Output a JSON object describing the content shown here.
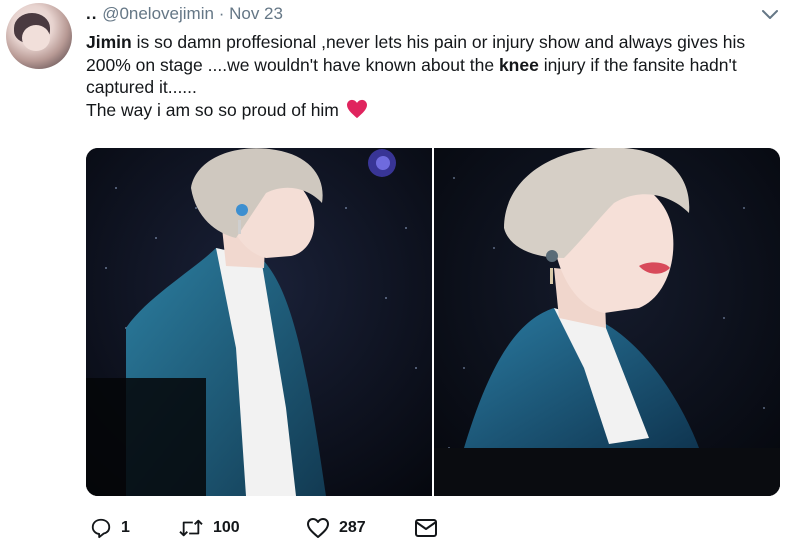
{
  "tweet": {
    "display_name": "..",
    "handle": "@0nelovejimin",
    "separator": "·",
    "date": "Nov 23",
    "body": {
      "part1_bold": "Jimin",
      "part2": " is so damn proffesional ,never lets his pain or injury show and always gives his 200% on stage ....we wouldn't have known about the ",
      "part3_bold": "knee",
      "part4": " injury if the fansite hadn't captured it......",
      "line2": "The way i am so so proud of him"
    },
    "emoji": "red-heart-emoji"
  },
  "actions": {
    "reply_count": "1",
    "retweet_count": "100",
    "like_count": "287"
  },
  "icons": {
    "more": "chevron-down-icon",
    "reply": "reply-icon",
    "retweet": "retweet-icon",
    "like": "heart-icon",
    "dm": "envelope-icon"
  },
  "colors": {
    "text": "#14171a",
    "muted": "#657786",
    "heart": "#e0245e",
    "jacket": "#1f5f7e"
  }
}
